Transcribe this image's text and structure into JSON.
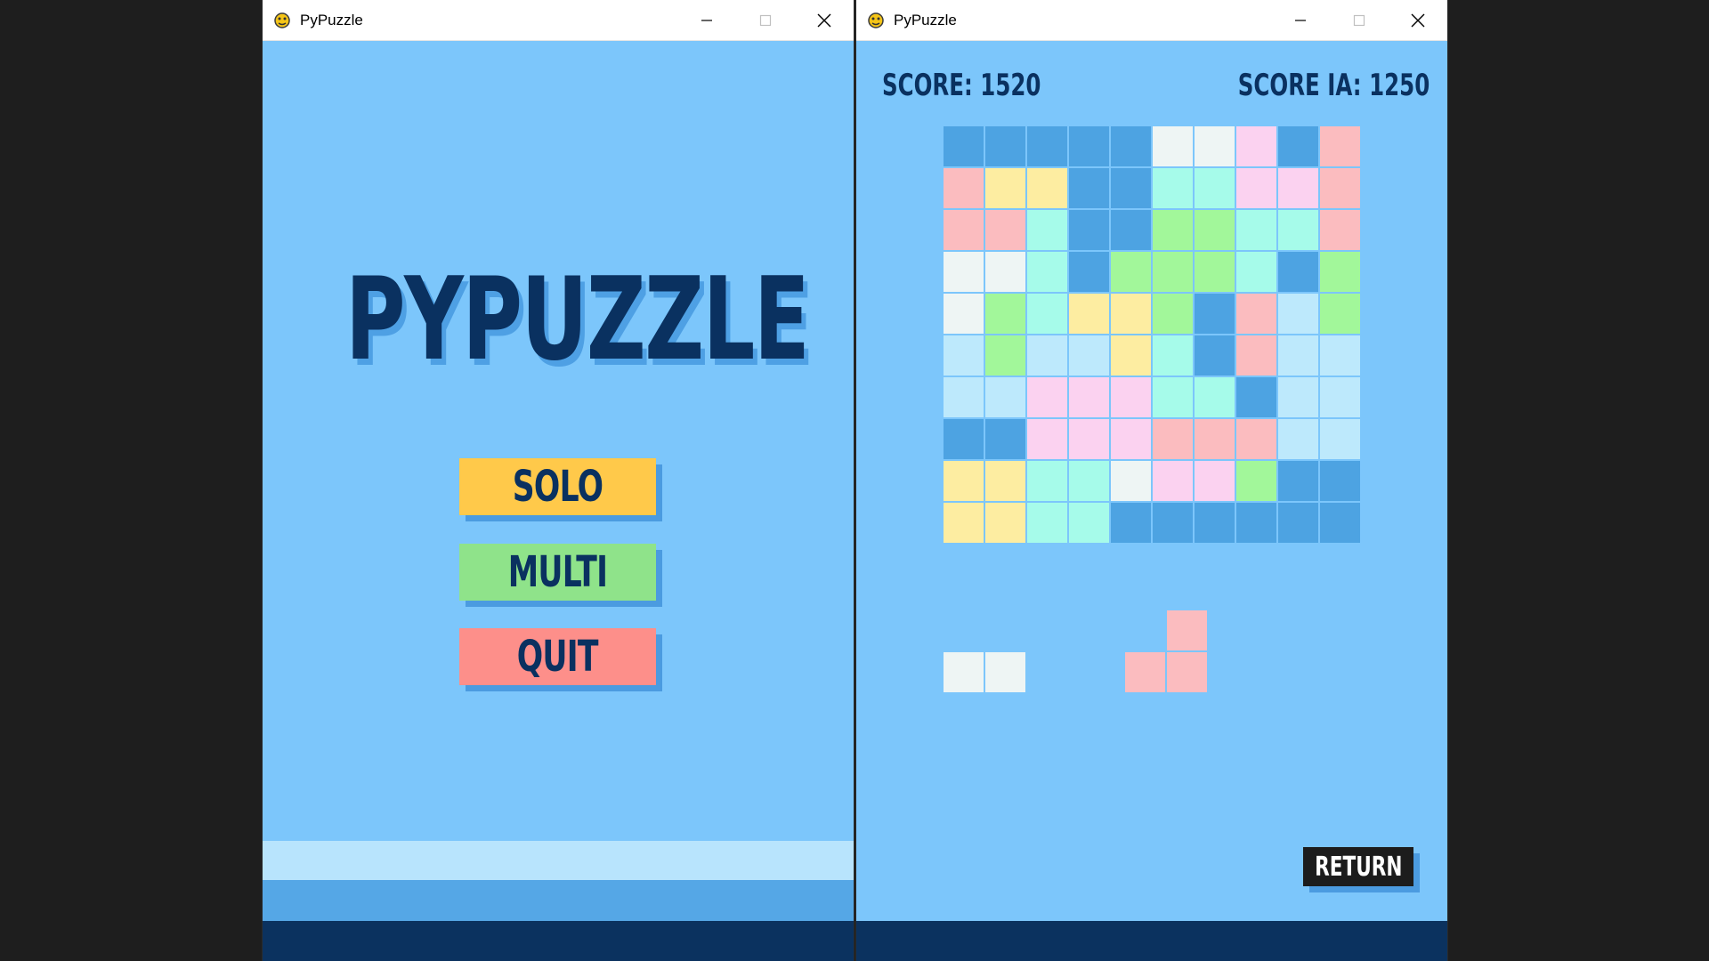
{
  "colors": {
    "dark_blue": "#4da3e2",
    "white": "#eef5f4",
    "pink": "#fbd2f0",
    "salmon": "#fbbcbf",
    "yellow": "#fdeda1",
    "mint": "#a6fbea",
    "green": "#a2f79a",
    "light_blue": "#bde9fc"
  },
  "menu_window": {
    "title": "PyPuzzle",
    "heading": "PYPUZZLE",
    "buttons": {
      "solo": "SOLO",
      "multi": "MULTI",
      "quit": "QUIT"
    }
  },
  "game_window": {
    "title": "PyPuzzle",
    "score_player": "SCORE: 1520",
    "score_ai": "SCORE IA: 1250",
    "return_label": "RETURN",
    "grid": [
      [
        "dark_blue",
        "dark_blue",
        "dark_blue",
        "dark_blue",
        "dark_blue",
        "white",
        "white",
        "pink",
        "dark_blue",
        "salmon"
      ],
      [
        "salmon",
        "yellow",
        "yellow",
        "dark_blue",
        "dark_blue",
        "mint",
        "mint",
        "pink",
        "pink",
        "salmon"
      ],
      [
        "salmon",
        "salmon",
        "mint",
        "dark_blue",
        "dark_blue",
        "green",
        "green",
        "mint",
        "mint",
        "salmon"
      ],
      [
        "white",
        "white",
        "mint",
        "dark_blue",
        "green",
        "green",
        "green",
        "mint",
        "dark_blue",
        "green"
      ],
      [
        "white",
        "green",
        "mint",
        "yellow",
        "yellow",
        "green",
        "dark_blue",
        "salmon",
        "light_blue",
        "green"
      ],
      [
        "light_blue",
        "green",
        "light_blue",
        "light_blue",
        "yellow",
        "mint",
        "dark_blue",
        "salmon",
        "light_blue",
        "light_blue"
      ],
      [
        "light_blue",
        "light_blue",
        "pink",
        "pink",
        "pink",
        "mint",
        "mint",
        "dark_blue",
        "light_blue",
        "light_blue"
      ],
      [
        "dark_blue",
        "dark_blue",
        "pink",
        "pink",
        "pink",
        "salmon",
        "salmon",
        "salmon",
        "light_blue",
        "light_blue"
      ],
      [
        "yellow",
        "yellow",
        "mint",
        "mint",
        "white",
        "pink",
        "pink",
        "green",
        "dark_blue",
        "dark_blue"
      ],
      [
        "yellow",
        "yellow",
        "mint",
        "mint",
        "dark_blue",
        "dark_blue",
        "dark_blue",
        "dark_blue",
        "dark_blue",
        "dark_blue"
      ]
    ],
    "pieces": [
      {
        "name": "piece-white-domino",
        "color": "white",
        "cells": [
          [
            0,
            0
          ],
          [
            1,
            0
          ]
        ]
      },
      {
        "name": "piece-salmon-l",
        "color": "salmon",
        "cells": [
          [
            1,
            0
          ],
          [
            0,
            1
          ],
          [
            1,
            1
          ]
        ]
      }
    ]
  }
}
